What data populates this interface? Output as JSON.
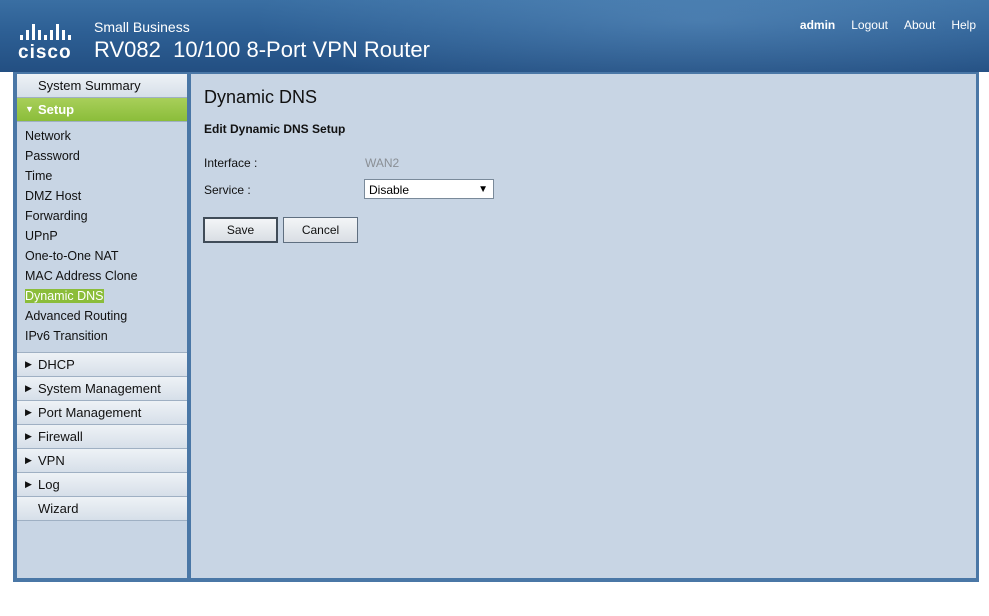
{
  "header": {
    "brand": "cisco",
    "small_business": "Small Business",
    "product_title": "RV082  10/100 8-Port VPN Router",
    "links": {
      "user": "admin",
      "logout": "Logout",
      "about": "About",
      "help": "Help"
    }
  },
  "sidebar": {
    "system_summary": "System Summary",
    "setup": "Setup",
    "setup_items": [
      "Network",
      "Password",
      "Time",
      "DMZ Host",
      "Forwarding",
      "UPnP",
      "One-to-One NAT",
      "MAC Address Clone",
      "Dynamic DNS",
      "Advanced Routing",
      "IPv6 Transition"
    ],
    "current_item": "Dynamic DNS",
    "sections": [
      "DHCP",
      "System Management",
      "Port Management",
      "Firewall",
      "VPN",
      "Log"
    ],
    "wizard": "Wizard"
  },
  "main": {
    "title": "Dynamic DNS",
    "section": "Edit Dynamic DNS Setup",
    "interface_label": "Interface :",
    "interface_value": "WAN2",
    "service_label": "Service :",
    "service_value": "Disable",
    "save": "Save",
    "cancel": "Cancel"
  },
  "colors": {
    "accent_green": "#8bbd3a",
    "header_blue": "#2d5f94",
    "panel_bg": "#c8d5e4"
  },
  "icons": {
    "logo": "cisco-logo",
    "expanded": "triangle-down-icon",
    "collapsed": "triangle-right-icon",
    "dropdown": "caret-down-icon"
  }
}
